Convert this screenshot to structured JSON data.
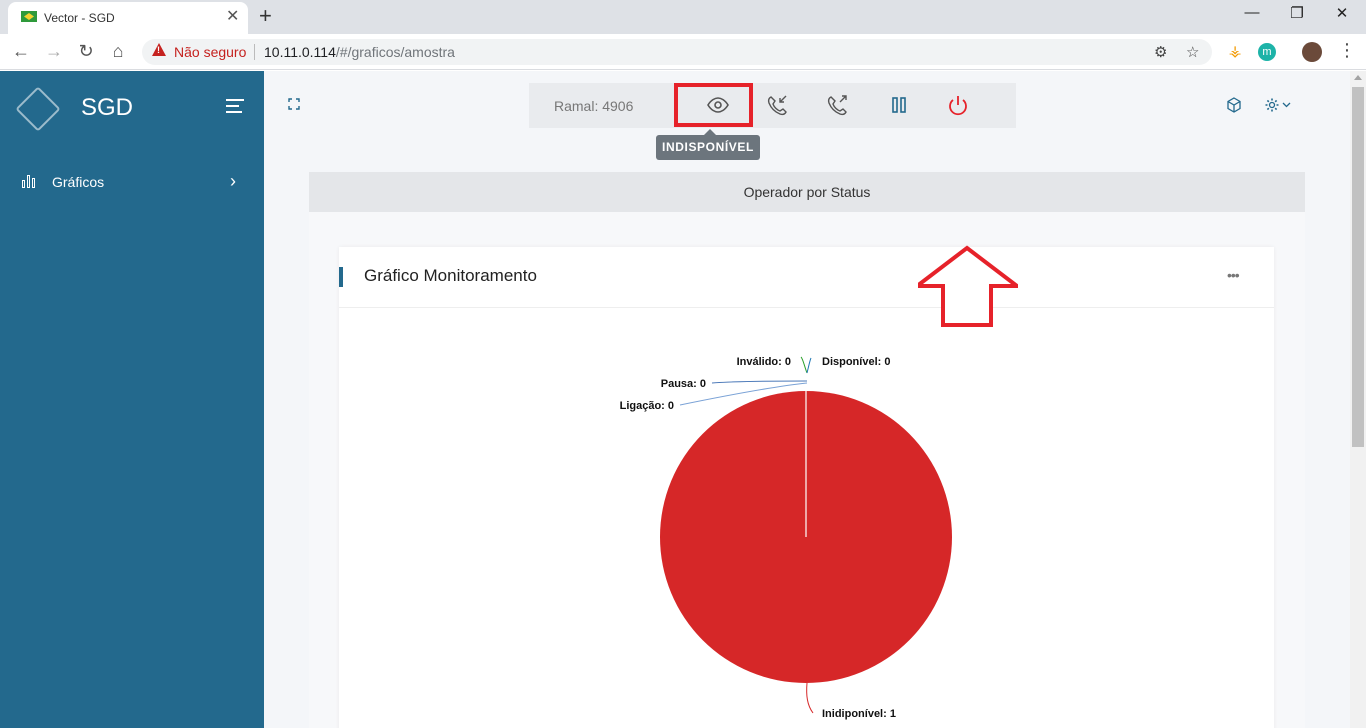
{
  "browser": {
    "tab_title": "Vector - SGD",
    "tab_close": "✕",
    "new_tab": "+",
    "security_label": "Não seguro",
    "url_host": "10.11.0.114",
    "url_path": "/#/graficos/amostra",
    "extension_letter": "m"
  },
  "sidebar": {
    "brand": "SGD",
    "items": [
      {
        "label": "Gráficos",
        "icon": "bar-chart-icon"
      }
    ]
  },
  "toolbar": {
    "ramal_label": "Ramal: 4906",
    "tooltip": "INDISPONÍVEL",
    "buttons": [
      "eye-icon",
      "incoming-call-icon",
      "outgoing-call-icon",
      "pause-icon",
      "power-icon"
    ]
  },
  "panel": {
    "status_title": "Operador por Status"
  },
  "card": {
    "title": "Gráfico Monitoramento",
    "more": "•••"
  },
  "colors": {
    "sidebar": "#23698d",
    "accent": "#23698d",
    "danger": "#e6222a",
    "pie_red": "#d62728"
  },
  "chart_data": {
    "type": "pie",
    "slices": [
      {
        "label": "Inválido: 0",
        "name": "Inválido",
        "value": 0,
        "color": "#2ca02c"
      },
      {
        "label": "Disponível: 0",
        "name": "Disponível",
        "value": 0,
        "color": "#1f77b4"
      },
      {
        "label": "Pausa: 0",
        "name": "Pausa",
        "value": 0,
        "color": "#4a78b8"
      },
      {
        "label": "Ligação: 0",
        "name": "Ligação",
        "value": 0,
        "color": "#7aa2d6"
      },
      {
        "label": "Inidiponível: 1",
        "name": "Inidiponível",
        "value": 1,
        "color": "#d62728"
      }
    ]
  }
}
